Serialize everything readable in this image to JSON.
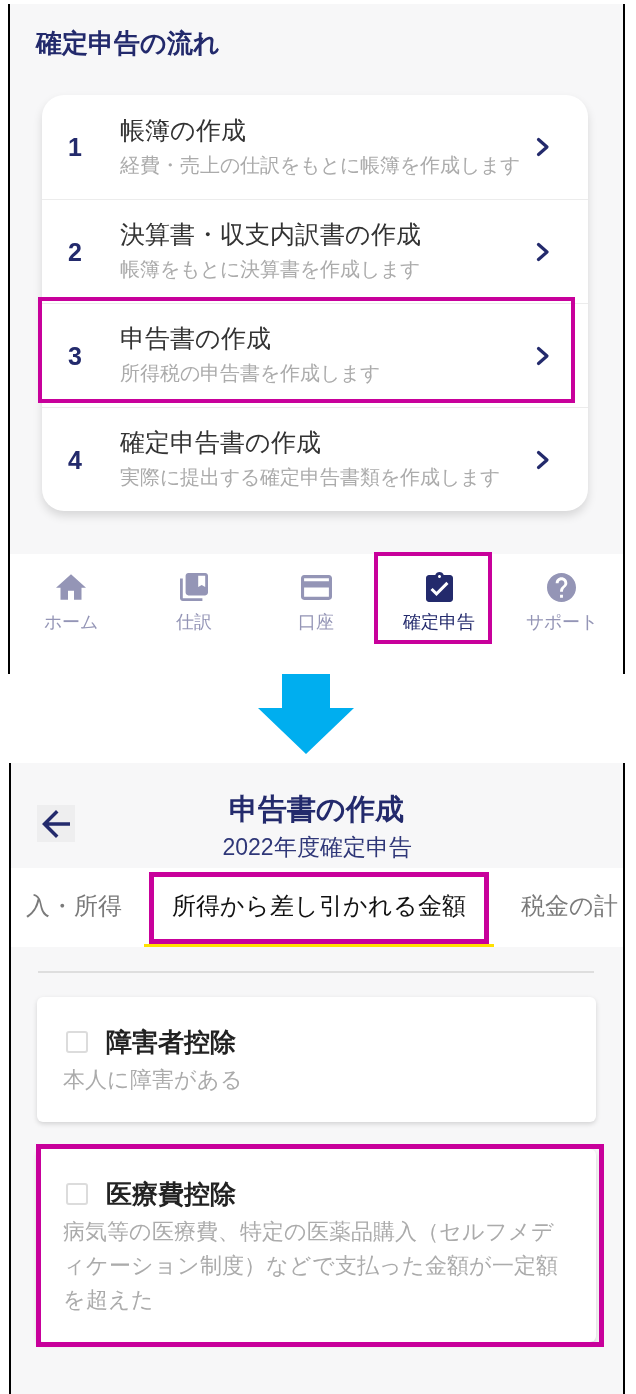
{
  "flow_screen": {
    "title": "確定申告の流れ",
    "steps": [
      {
        "number": "1",
        "title": "帳簿の作成",
        "description": "経費・売上の仕訳をもとに帳簿を作成します",
        "highlighted": false
      },
      {
        "number": "2",
        "title": "決算書・収支内訳書の作成",
        "description": "帳簿をもとに決算書を作成します",
        "highlighted": false
      },
      {
        "number": "3",
        "title": "申告書の作成",
        "description": "所得税の申告書を作成します",
        "highlighted": true
      },
      {
        "number": "4",
        "title": "確定申告書の作成",
        "description": "実際に提出する確定申告書類を作成します",
        "highlighted": false
      }
    ],
    "bottom_nav": [
      {
        "label": "ホーム",
        "selected": false,
        "highlighted": false
      },
      {
        "label": "仕訳",
        "selected": false,
        "highlighted": false
      },
      {
        "label": "口座",
        "selected": false,
        "highlighted": false
      },
      {
        "label": "確定申告",
        "selected": true,
        "highlighted": true
      },
      {
        "label": "サポート",
        "selected": false,
        "highlighted": false
      }
    ]
  },
  "form_screen": {
    "title": "申告書の作成",
    "subtitle": "2022年度確定申告",
    "tabs": [
      {
        "label": "入・所得",
        "selected": false,
        "highlighted": false
      },
      {
        "label": "所得から差し引かれる金額",
        "selected": true,
        "highlighted": true
      },
      {
        "label": "税金の計",
        "selected": false,
        "highlighted": false
      }
    ],
    "deductions": [
      {
        "title": "障害者控除",
        "description": "本人に障害がある",
        "checked": false,
        "highlighted": false
      },
      {
        "title": "医療費控除",
        "description": "病気等の医療費、特定の医薬品購入（セルフメディケーション制度）などで支払った金額が一定額を超えた",
        "checked": false,
        "highlighted": true
      }
    ]
  }
}
